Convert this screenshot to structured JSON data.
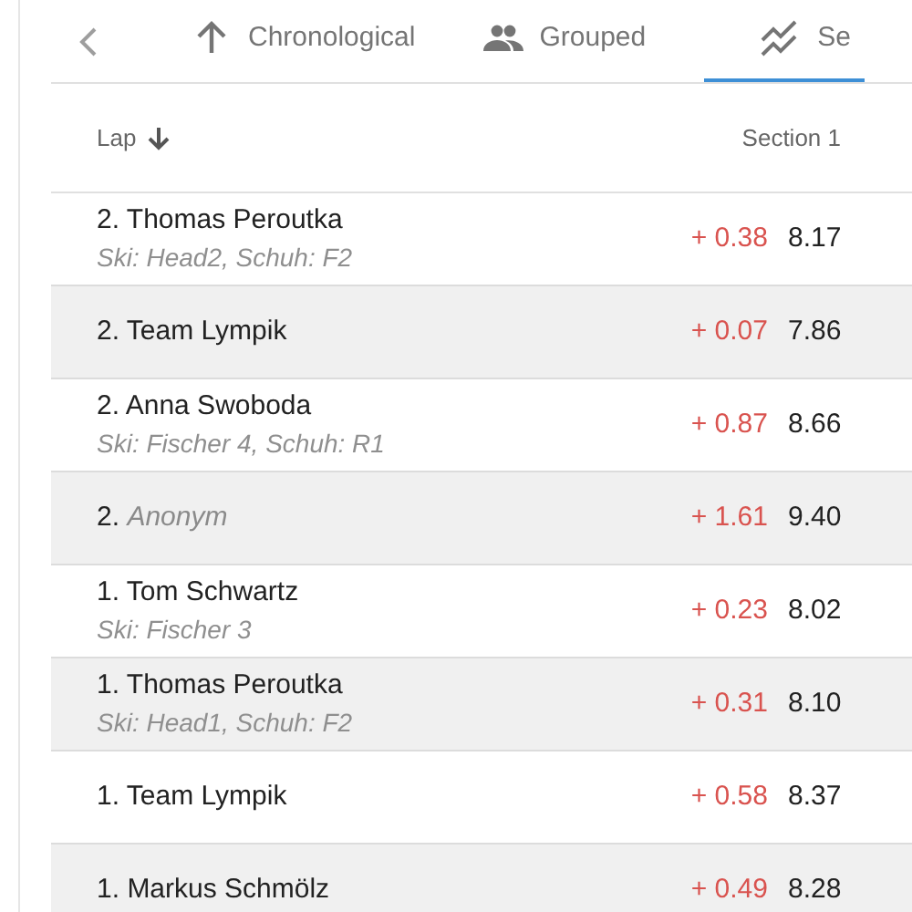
{
  "tabs": [
    {
      "label": "Chronological",
      "selected": false
    },
    {
      "label": "Grouped",
      "selected": false
    },
    {
      "label": "Se",
      "selected": true
    }
  ],
  "table": {
    "columns": [
      {
        "label": "Lap"
      },
      {
        "label": "Section 1"
      }
    ],
    "rows": [
      {
        "rank": "2.",
        "name": "Thomas Peroutka",
        "anonymous": false,
        "detail": "Ski: Head2, Schuh: F2",
        "delta": "+ 0.38",
        "time": "8.17"
      },
      {
        "rank": "2.",
        "name": "Team Lympik",
        "anonymous": false,
        "delta": "+ 0.07",
        "time": "7.86"
      },
      {
        "rank": "2.",
        "name": "Anna Swoboda",
        "anonymous": false,
        "detail": "Ski: Fischer 4, Schuh: R1",
        "delta": "+ 0.87",
        "time": "8.66"
      },
      {
        "rank": "2.",
        "name": "Anonym",
        "anonymous": true,
        "delta": "+ 1.61",
        "time": "9.40"
      },
      {
        "rank": "1.",
        "name": "Tom Schwartz",
        "anonymous": false,
        "detail": "Ski: Fischer 3",
        "delta": "+ 0.23",
        "time": "8.02"
      },
      {
        "rank": "1.",
        "name": "Thomas Peroutka",
        "anonymous": false,
        "detail": "Ski: Head1, Schuh: F2",
        "delta": "+ 0.31",
        "time": "8.10"
      },
      {
        "rank": "1.",
        "name": "Team Lympik",
        "anonymous": false,
        "delta": "+ 0.58",
        "time": "8.37"
      },
      {
        "rank": "1.",
        "name": "Markus Schmölz",
        "anonymous": false,
        "delta": "+ 0.49",
        "time": "8.28"
      }
    ]
  }
}
